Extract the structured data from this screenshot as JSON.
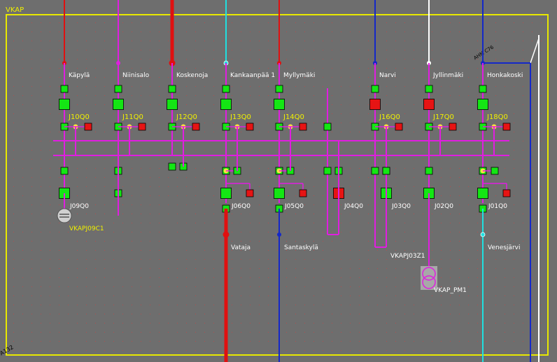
{
  "station": {
    "name": "VKAP",
    "corner_label": "A132",
    "switch_label": "AHM C76"
  },
  "colors": {
    "background": "#6e6e6e",
    "frame": "#e8e800",
    "busbar": "#e01ee0",
    "closed": "#14e614",
    "open": "#e61414",
    "point": "#ffe040",
    "label_white": "#ffffff",
    "label_yellow": "#f0f000",
    "line_red": "#e01010",
    "line_cyan": "#20e0e0",
    "line_blue": "#1428c8",
    "line_white": "#ffffff"
  },
  "top_feeders": [
    {
      "name": "Käpylä",
      "bay": "J10Q0",
      "line_color": "red",
      "breaker_closed": true
    },
    {
      "name": "Niinisalo",
      "bay": "J11Q0",
      "line_color": "magenta",
      "breaker_closed": true
    },
    {
      "name": "Koskenoja",
      "bay": "J12Q0",
      "line_color": "red",
      "breaker_closed": true
    },
    {
      "name": "Kankaanpää 1",
      "bay": "J13Q0",
      "line_color": "cyan",
      "breaker_closed": true
    },
    {
      "name": "Myllymäki",
      "bay": "J14Q0",
      "line_color": "red",
      "breaker_closed": true
    },
    {
      "name": "Narvi",
      "bay": "J16Q0",
      "line_color": "blue",
      "breaker_closed": false
    },
    {
      "name": "Jyllinmäki",
      "bay": "J17Q0",
      "line_color": "white",
      "breaker_closed": false
    },
    {
      "name": "Honkakoski",
      "bay": "J18Q0",
      "line_color": "blue",
      "breaker_closed": true
    }
  ],
  "bottom_feeders": [
    {
      "bay": "J09Q0",
      "name": "VKAPJ09C1",
      "breaker_closed": true
    },
    {
      "bay": "J06Q0",
      "name": "Vataja",
      "breaker_closed": true
    },
    {
      "bay": "J05Q0",
      "name": "Santaskylä",
      "breaker_closed": true
    },
    {
      "bay": "J04Q0",
      "name": "",
      "breaker_closed": false
    },
    {
      "bay": "J03Q0",
      "name": "VKAPJ03Z1",
      "breaker_closed": true
    },
    {
      "bay": "J02Q0",
      "name": "",
      "breaker_closed": true
    },
    {
      "bay": "J01Q0",
      "name": "Venesjärvi",
      "breaker_closed": true
    }
  ],
  "transformer": {
    "name": "VKAP_PM1"
  }
}
